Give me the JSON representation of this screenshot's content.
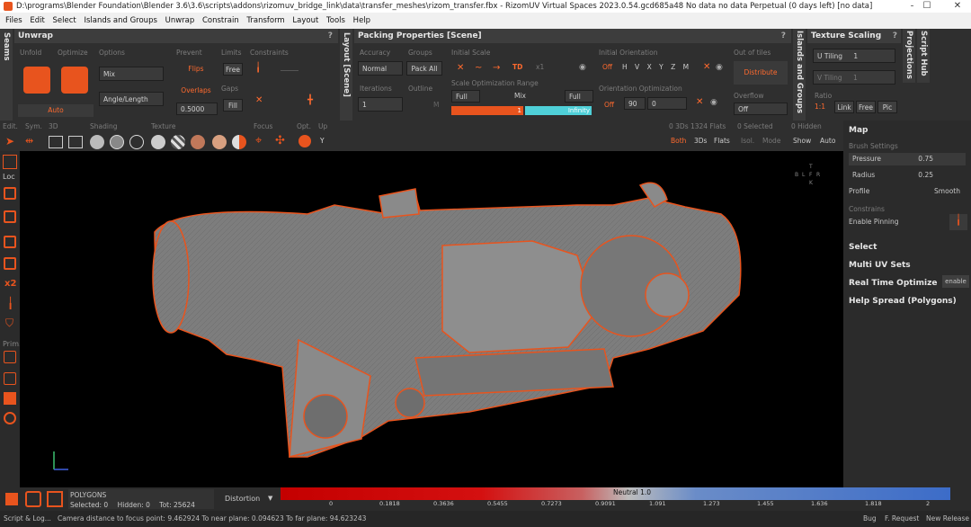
{
  "title": "D:\\programs\\Blender Foundation\\Blender 3.6\\3.6\\scripts\\addons\\rizomuv_bridge_link\\data\\transfer_meshes\\rizom_transfer.fbx - RizomUV  Virtual Spaces 2023.0.54.gcd685a48 No data no data Perpetual  (0 days left) [no data]",
  "window_controls": [
    "–",
    "☐",
    "✕"
  ],
  "menu": [
    "Files",
    "Edit",
    "Select",
    "Islands and Groups",
    "Unwrap",
    "Constrain",
    "Transform",
    "Layout",
    "Tools",
    "Help"
  ],
  "unwrap": {
    "side_label": "Seams",
    "header": "Unwrap",
    "help": "?",
    "labels": {
      "unfold": "Unfold",
      "optimize": "Optimize",
      "options": "Options",
      "prevent": "Prevent",
      "limits": "Limits",
      "constraints": "Constraints",
      "gaps": "Gaps"
    },
    "auto": "Auto",
    "mix": "Mix",
    "angle_length": "Angle/Length",
    "flips": "Flips",
    "overlaps": "Overlaps",
    "value": "0.5000",
    "free": "Free",
    "fill": "Fill"
  },
  "packing": {
    "side_label": "Layout [Scene]",
    "header": "Packing Properties [Scene]",
    "help": "?",
    "labels": {
      "accuracy": "Accuracy",
      "groups": "Groups",
      "iterations": "Iterations",
      "outline": "Outline",
      "initial_scale": "Initial Scale",
      "scale_range": "Scale Optimization Range",
      "initial_orientation": "Initial Orientation",
      "orientation_opt": "Orientation Optimization",
      "out_of_tiles": "Out of tiles",
      "overflow": "Overflow"
    },
    "normal": "Normal",
    "pack_all": "Pack All",
    "iterations_val": "1",
    "outline_m": "M",
    "td": "TD",
    "x1": "x1",
    "full": "Full",
    "mix": "Mix",
    "full2": "Full",
    "range_min": "1",
    "range_max": "Infinity",
    "off": "Off",
    "axes": [
      "H",
      "V",
      "X",
      "Y",
      "Z",
      "M"
    ],
    "off2": "Off",
    "deg": "90",
    "zero": "0",
    "distribute": "Distribute",
    "overflow_val": "Off"
  },
  "texture": {
    "side_label": "Islands and Groups",
    "header": "Texture Scaling",
    "help": "?",
    "u_tiling_label": "U Tiling",
    "u_tiling": "1",
    "v_tiling_label": "V Tiling",
    "v_tiling": "1",
    "ratio_label": "Ratio",
    "ratio": "1:1",
    "link": "Link",
    "free": "Free",
    "pic": "Pic",
    "right_labels": [
      "Projections",
      "Script Hub"
    ]
  },
  "view3d": {
    "labels": [
      "Edit.",
      "Sym.",
      "3D",
      "Shading",
      "Texture",
      "Focus",
      "Opt.",
      "Up"
    ],
    "up_val": "Y",
    "count_3d": "0 3Ds 1324 Flats",
    "selected": "0 Selected",
    "hidden": "0 Hidden",
    "both": "Both",
    "threeds": "3Ds",
    "flats": "Flats",
    "isol": "Isol.",
    "mode": "Mode",
    "show": "Show",
    "auto": "Auto"
  },
  "left_tools": {
    "loc": "Loc",
    "x2": "x2",
    "prim": "Prim."
  },
  "axis_cube": [
    "T",
    "B",
    "L",
    "F",
    "R",
    "K"
  ],
  "map_panel": {
    "header": "Map",
    "brush_settings": "Brush Settings",
    "pressure_label": "Pressure",
    "pressure": "0.75",
    "radius_label": "Radius",
    "radius": "0.25",
    "profile_label": "Profile",
    "profile": "Smooth",
    "constrains": "Constrains",
    "enable_pinning": "Enable Pinning",
    "sections": [
      "Select",
      "Multi UV Sets",
      "Real Time Optimize",
      "Help Spread (Polygons)"
    ],
    "enable": "enable"
  },
  "bottom": {
    "mode": "POLYGONS",
    "selected": "Selected: 0",
    "hidden": "Hidden: 0",
    "total": "Tot: 25624",
    "distortion": "Distortion",
    "neutral": "Neutral 1.0",
    "ticks": [
      "0",
      "0.1818",
      "0.3636",
      "0.5455",
      "0.7273",
      "0.9091",
      "1.091",
      "1.273",
      "1.455",
      "1.636",
      "1.818",
      "2"
    ]
  },
  "status": {
    "script": "Script & Log...",
    "message": "Camera distance to focus point: 9.462924  To near plane: 0.094623  To far plane: 94.623243",
    "bug": "Bug",
    "request": "F. Request",
    "release": "New Release"
  },
  "colors": {
    "accent": "#e8541e",
    "panel": "#2f2f2f",
    "viewport": "#000000"
  }
}
